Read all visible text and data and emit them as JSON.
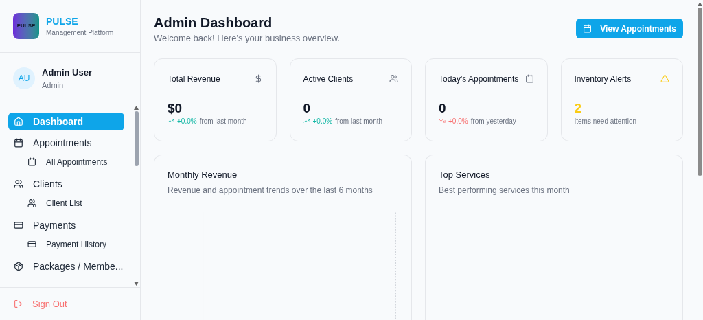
{
  "brand": {
    "logo_text": "PULSE",
    "name": "PULSE",
    "tagline": "Management Platform"
  },
  "user": {
    "initials": "AU",
    "name": "Admin User",
    "role": "Admin"
  },
  "nav": [
    {
      "label": "Dashboard",
      "selected": true
    },
    {
      "label": "Appointments",
      "selected": false,
      "children": [
        {
          "label": "All Appointments",
          "selected": false
        }
      ]
    },
    {
      "label": "Clients",
      "selected": false,
      "children": [
        {
          "label": "Client List",
          "selected": false
        }
      ]
    },
    {
      "label": "Payments",
      "selected": false,
      "children": [
        {
          "label": "Payment History",
          "selected": false
        }
      ]
    },
    {
      "label": "Packages / Membe...",
      "selected": false
    }
  ],
  "sign_out": "Sign Out",
  "header": {
    "title": "Admin Dashboard",
    "subtitle": "Welcome back! Here's your business overview.",
    "action": "View Appointments"
  },
  "stats": [
    {
      "kind": "rise",
      "title": "Total Revenue",
      "value": "$0",
      "change": "+0.0%",
      "note": "from last month"
    },
    {
      "kind": "rise",
      "title": "Active Clients",
      "value": "0",
      "change": "+0.0%",
      "note": "from last month"
    },
    {
      "kind": "fall",
      "title": "Today's Appointments",
      "value": "0",
      "change": "+0.0%",
      "note": "from yesterday"
    },
    {
      "kind": "alert",
      "title": "Inventory Alerts",
      "value": "2",
      "note": "Items need attention"
    }
  ],
  "panels": [
    {
      "kind": "chart",
      "title": "Monthly Revenue",
      "subtitle": "Revenue and appointment trends over the last 6 months"
    },
    {
      "kind": "empty",
      "title": "Top Services",
      "subtitle": "Best performing services this month"
    }
  ]
}
